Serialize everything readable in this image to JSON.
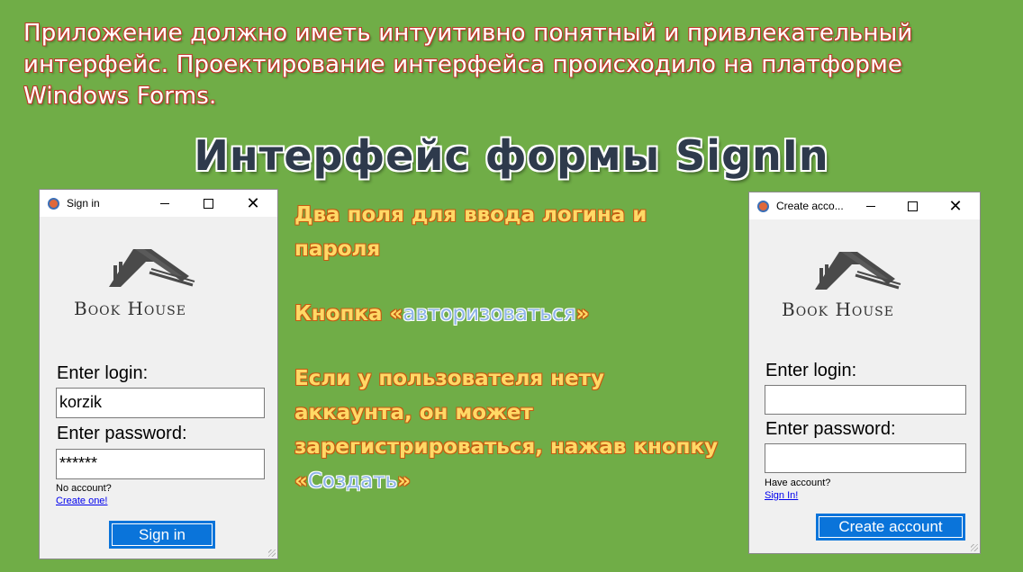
{
  "slide": {
    "intro": "Приложение должно иметь интуитивно понятный и привлекательный интерфейс. Проектирование интерфейса происходило на платформе Windows Forms.",
    "title": "Интерфейс формы SignIn",
    "bullet1": "Два поля для ввода логина  и пароля",
    "bullet2_prefix": "Кнопка «",
    "bullet2_highlight": "авторизоваться",
    "bullet2_suffix": "»",
    "bullet3_prefix": "Если у пользователя нету аккаунта, он может зарегистрироваться, нажав кнопку «",
    "bullet3_highlight": "Создать",
    "bullet3_suffix": "»"
  },
  "signin_form": {
    "window_title": "Sign in",
    "brand": "Book House",
    "login_label": "Enter login:",
    "login_value": "korzik",
    "password_label": "Enter password:",
    "password_value": "******",
    "no_account_text": "No account?",
    "create_link": "Create one!",
    "signin_button": "Sign in",
    "close_glyph": "✕"
  },
  "create_form": {
    "window_title": "Create acco...",
    "brand": "Book House",
    "login_label": "Enter login:",
    "login_value": "",
    "password_label": "Enter password:",
    "password_value": "",
    "have_account_text": "Have account?",
    "signin_link": "Sign In!",
    "create_button": "Create account",
    "close_glyph": "✕"
  },
  "colors": {
    "background": "#70ad47",
    "button": "#0a74da",
    "bullet_text": "#ffd966",
    "title_text": "#2e3a4c"
  },
  "icons": [
    "house-logo-icon",
    "app-icon",
    "minimize-icon",
    "maximize-icon",
    "close-icon"
  ]
}
